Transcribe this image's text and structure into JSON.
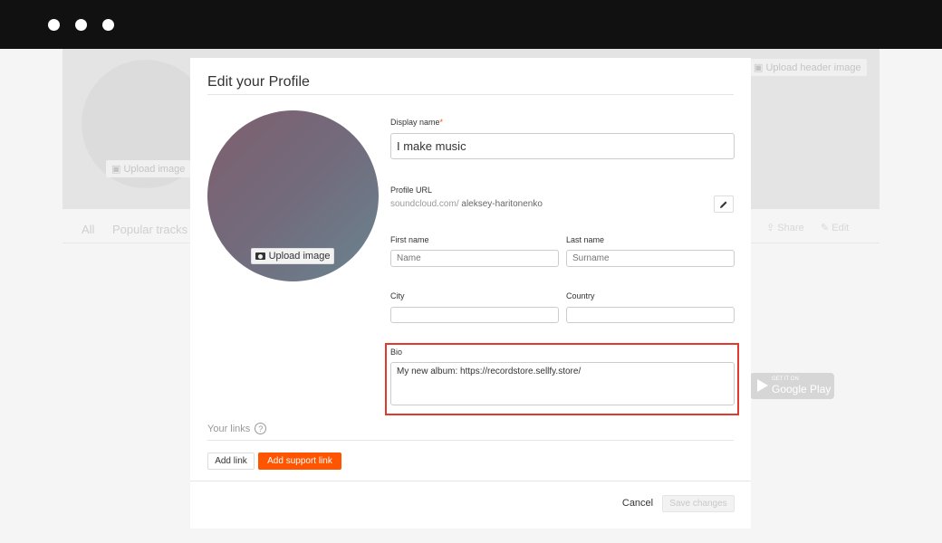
{
  "background": {
    "upload_header_label": "Upload header image",
    "upload_image_label": "Upload image",
    "tabs": [
      "All",
      "Popular tracks"
    ],
    "share_label": "Share",
    "edit_label": "Edit",
    "google_play": {
      "small": "GET IT ON",
      "big": "Google Play"
    }
  },
  "modal": {
    "title": "Edit your Profile",
    "upload_image_label": "Upload image",
    "display_name": {
      "label": "Display name",
      "required_mark": "*",
      "value": "I make music"
    },
    "profile_url": {
      "label": "Profile URL",
      "prefix": "soundcloud.com/",
      "slug": "aleksey-haritonenko"
    },
    "first_name": {
      "label": "First name",
      "placeholder": "Name"
    },
    "last_name": {
      "label": "Last name",
      "placeholder": "Surname"
    },
    "city": {
      "label": "City",
      "value": ""
    },
    "country": {
      "label": "Country",
      "value": ""
    },
    "bio": {
      "label": "Bio",
      "value": "My new album: https://recordstore.sellfy.store/"
    },
    "links": {
      "label": "Your links",
      "help": "?"
    },
    "buttons": {
      "add_link": "Add link",
      "add_support_link": "Add support link",
      "cancel": "Cancel",
      "save_changes": "Save changes"
    }
  },
  "colors": {
    "accent": "#ff5500",
    "highlight": "#e03a2f",
    "titlebar": "#111111"
  }
}
